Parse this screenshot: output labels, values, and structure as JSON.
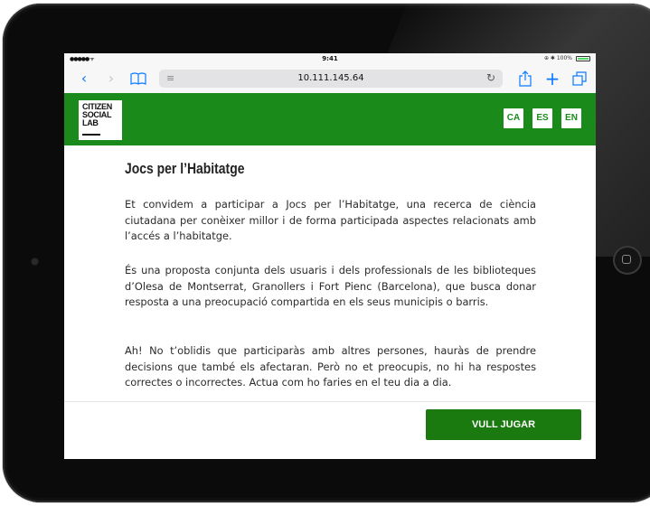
{
  "statusbar": {
    "signal": "●●●●● ᯤ",
    "time": "9:41",
    "battery": "⊕ ✱ 100%"
  },
  "browser": {
    "url": "10.111.145.64",
    "icons": {
      "back": "chevron-left-icon",
      "forward": "chevron-right-icon",
      "bookmarks": "book-icon",
      "reader": "reader-icon",
      "reload": "reload-icon",
      "share": "share-icon",
      "new_tab": "plus-icon",
      "tabs": "tabs-icon"
    }
  },
  "header": {
    "logo_lines": [
      "CITIZEN",
      "SOCIAL",
      "LAB"
    ],
    "languages": [
      "CA",
      "ES",
      "EN"
    ],
    "color": "#1a8b1a"
  },
  "content": {
    "title": "Jocs per l’Habitatge",
    "paragraphs": [
      "Et convidem a participar a Jocs per l’Habitatge, una recerca de ciència ciutadana per conèixer millor i de forma participada aspectes relacionats amb l’accés a l’habitatge.",
      "És una proposta conjunta dels usuaris i dels professionals de les biblioteques d’Olesa de Montserrat, Granollers i Fort Pienc (Barcelona), que busca donar resposta a una preocupació compartida en els seus municipis o barris.",
      "Ah! No t’oblidis que participaràs amb altres persones, hauràs de prendre decisions que també els afectaran. Però no et preocupis, no hi ha respostes correctes o incorrectes. Actua com ho faries en el teu dia a dia."
    ]
  },
  "footer": {
    "cta_label": "VULL JUGAR",
    "cta_color": "#1a7a10"
  }
}
